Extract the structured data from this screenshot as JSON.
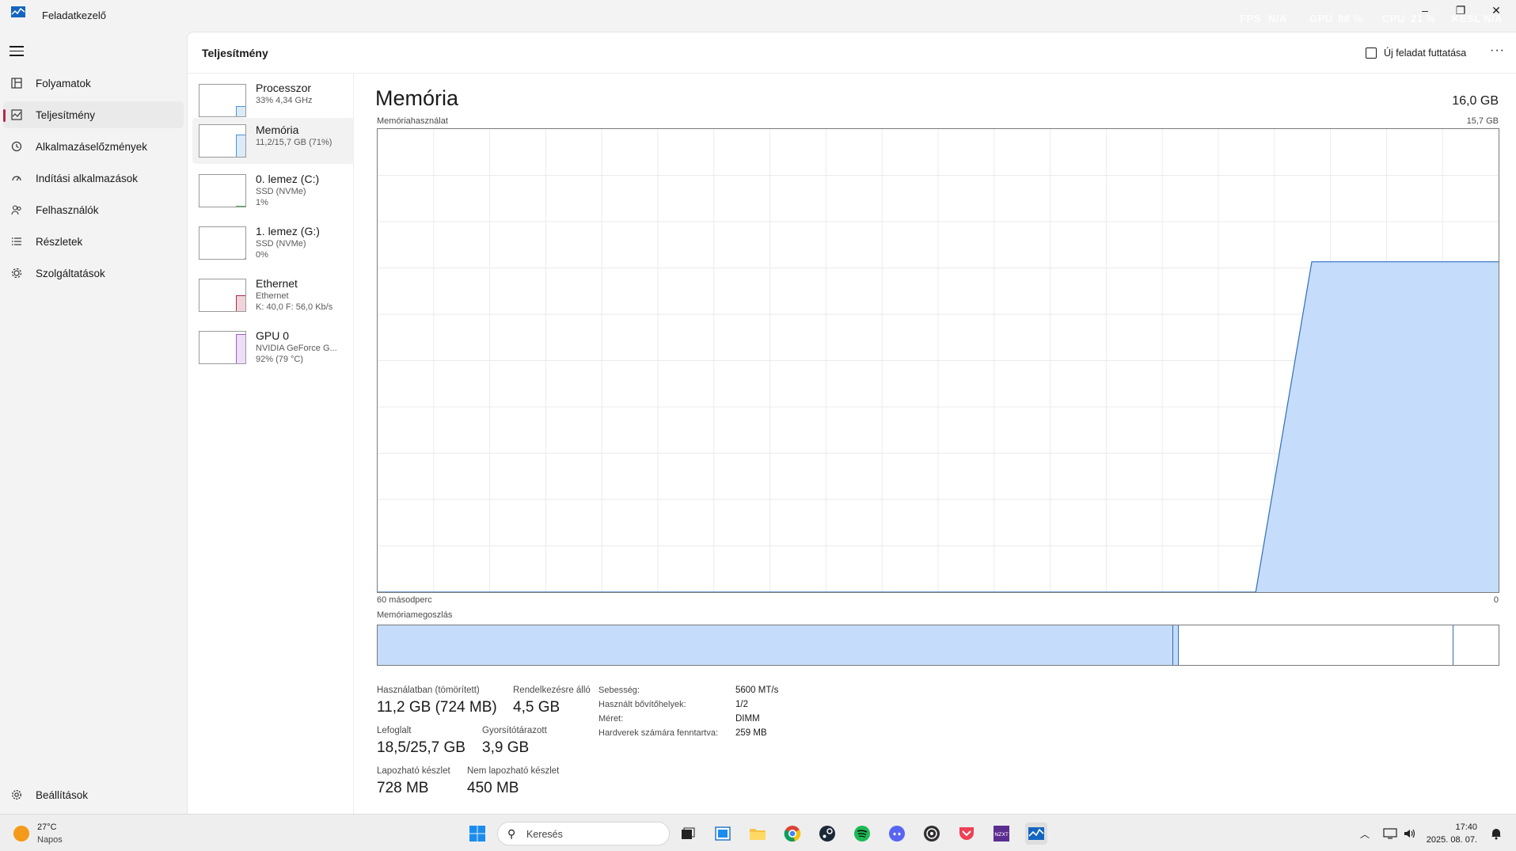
{
  "window": {
    "title": "Feladatkezelő",
    "overlay": [
      "FPS",
      "N/A",
      "GPU",
      "88 %",
      "CPU",
      "21 %",
      "KÉSL",
      "N/A"
    ],
    "controls": [
      "–",
      "❐",
      "✕"
    ]
  },
  "nav": {
    "items": [
      {
        "label": "Folyamatok",
        "icon": "processes-icon"
      },
      {
        "label": "Teljesítmény",
        "icon": "performance-icon",
        "active": true
      },
      {
        "label": "Alkalmazáselőzmények",
        "icon": "history-icon"
      },
      {
        "label": "Indítási alkalmazások",
        "icon": "startup-icon"
      },
      {
        "label": "Felhasználók",
        "icon": "users-icon"
      },
      {
        "label": "Részletek",
        "icon": "details-icon"
      },
      {
        "label": "Szolgáltatások",
        "icon": "services-icon"
      }
    ],
    "settings": "Beállítások"
  },
  "header": {
    "title": "Teljesítmény",
    "run_task": "Új feladat futtatása",
    "more": "···"
  },
  "devices": [
    {
      "name": "Processzor",
      "sub1": "33% 4,34 GHz",
      "sub2": "",
      "level": 0.33,
      "color": "#4d95d8"
    },
    {
      "name": "Memória",
      "sub1": "11,2/15,7 GB (71%)",
      "sub2": "",
      "level": 0.71,
      "color": "#4d95d8",
      "selected": true
    },
    {
      "name": "0. lemez (C:)",
      "sub1": "SSD (NVMe)",
      "sub2": "1%",
      "level": 0.01,
      "color": "#4caf50"
    },
    {
      "name": "1. lemez (G:)",
      "sub1": "SSD (NVMe)",
      "sub2": "0%",
      "level": 0.0,
      "color": "#4caf50"
    },
    {
      "name": "Ethernet",
      "sub1": "Ethernet",
      "sub2": "K: 40,0 F: 56,0 Kb/s",
      "level": 0.5,
      "color": "#b4284c"
    },
    {
      "name": "GPU 0",
      "sub1": "NVIDIA GeForce G...",
      "sub2": "92% (79 °C)",
      "level": 0.92,
      "color": "#a25bd1"
    }
  ],
  "detail": {
    "title": "Memória",
    "total": "16,0 GB",
    "usage_label": "Memóriahasználat",
    "usage_max": "15,7 GB",
    "seconds_label": "60 másodperc",
    "zero_label": "0",
    "composition_label": "Memóriamegoszlás",
    "stats": [
      {
        "label": "Használatban (tömörített)",
        "value": "11,2 GB (724 MB)"
      },
      {
        "label": "Rendelkezésre álló",
        "value": "4,5 GB"
      },
      {
        "label": "Lefoglalt",
        "value": "18,5/25,7 GB"
      },
      {
        "label": "Gyorsítótárazott",
        "value": "3,9 GB"
      },
      {
        "label": "Lapozható készlet",
        "value": "728 MB"
      },
      {
        "label": "Nem lapozható készlet",
        "value": "450 MB"
      }
    ],
    "specs": [
      {
        "label": "Sebesség:",
        "value": "5600 MT/s"
      },
      {
        "label": "Használt bővítőhelyek:",
        "value": "1/2"
      },
      {
        "label": "Méret:",
        "value": "DIMM"
      },
      {
        "label": "Hardverek számára fenntartva:",
        "value": "259 MB"
      }
    ]
  },
  "chart_data": {
    "type": "area",
    "ylabel": "Memóriahasználat",
    "ylim": [
      0,
      15.7
    ],
    "x": [
      60,
      13,
      10,
      0
    ],
    "values": [
      0,
      0,
      11.2,
      11.2
    ],
    "xlabel": "60 másodperc",
    "grid": true,
    "composition": {
      "in_use": 0.71,
      "modified": 0.005,
      "standby": 0.245,
      "free": 0.04
    }
  },
  "taskbar": {
    "temp": "27°C",
    "condition": "Napos",
    "search": "Keresés",
    "time": "17:40",
    "date": "2025. 08. 07."
  },
  "colors": {
    "accent": "#b4284c",
    "memory_fill": "#c5dcfa",
    "memory_line": "#2f6fbf"
  }
}
